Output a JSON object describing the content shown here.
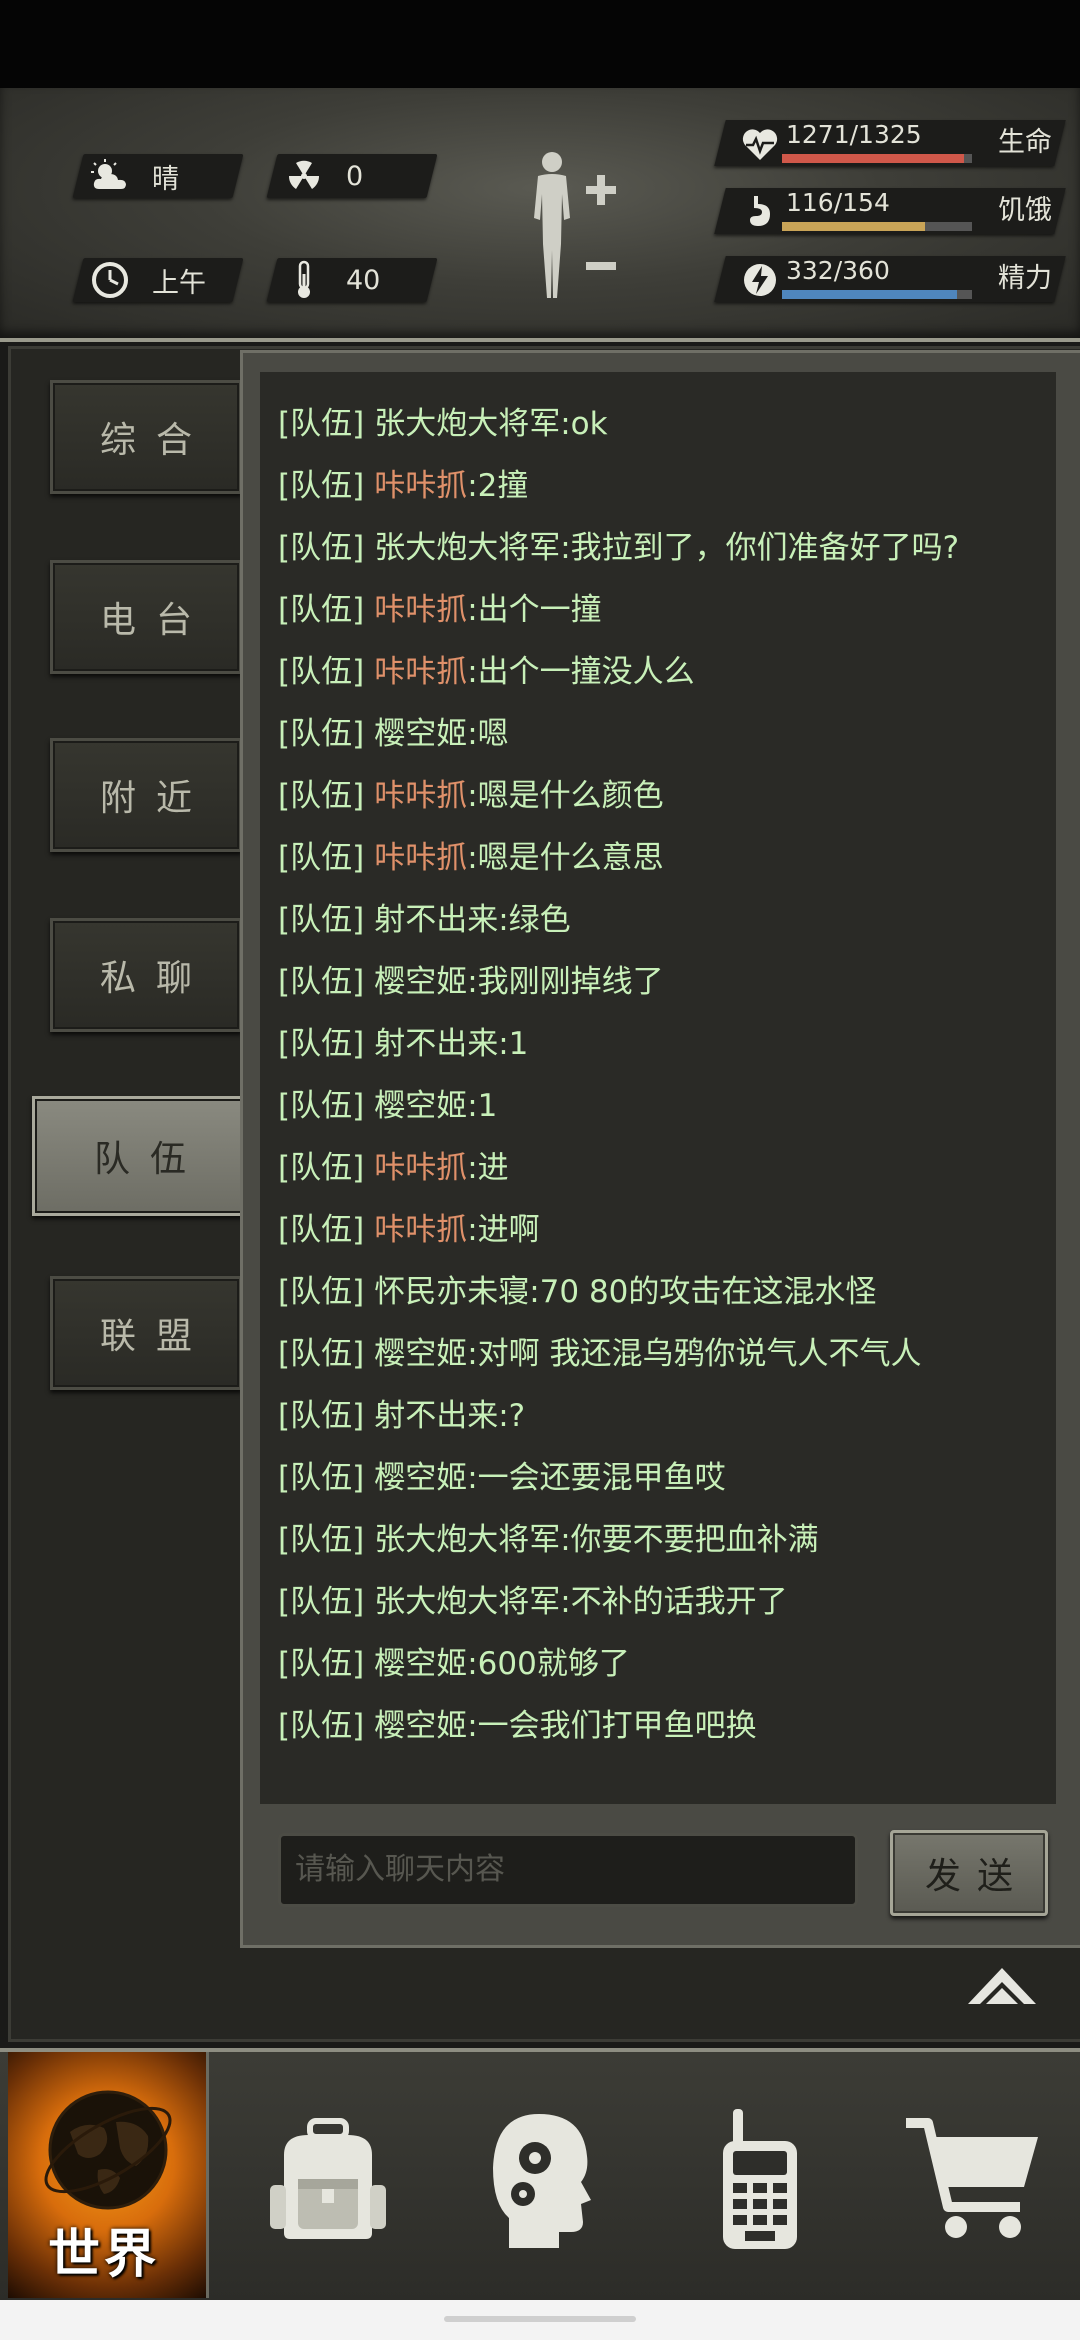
{
  "hud": {
    "weather_label": "晴",
    "radiation_value": "0",
    "time_label": "上午",
    "temperature_value": "40",
    "icons": [
      "partly-cloudy-icon",
      "radiation-icon",
      "clock-icon",
      "thermometer-icon",
      "body-figure-icon",
      "plus-icon",
      "minus-icon"
    ]
  },
  "stats": {
    "health": {
      "value": "1271/1325",
      "label": "生命",
      "fill": 0.959,
      "color": "#d0584a"
    },
    "hunger": {
      "value": "116/154",
      "label": "饥饿",
      "fill": 0.753,
      "color": "#c9a457"
    },
    "energy": {
      "value": "332/360",
      "label": "精力",
      "fill": 0.922,
      "color": "#4f86bd"
    }
  },
  "sidebar": {
    "items": [
      {
        "label": "综合"
      },
      {
        "label": "电台"
      },
      {
        "label": "附近"
      },
      {
        "label": "私聊"
      },
      {
        "label": "队伍",
        "active": true
      },
      {
        "label": "联盟"
      }
    ]
  },
  "chat": {
    "messages": [
      {
        "tag": "[队伍]",
        "speaker": "张大炮大将军",
        "text": ":ok",
        "highlight": false
      },
      {
        "tag": "[队伍]",
        "speaker": "咔咔抓",
        "text": ":2撞",
        "highlight": true
      },
      {
        "tag": "[队伍]",
        "speaker": "张大炮大将军",
        "text": ":我拉到了，你们准备好了吗?",
        "highlight": false
      },
      {
        "tag": "[队伍]",
        "speaker": "咔咔抓",
        "text": ":出个一撞",
        "highlight": true
      },
      {
        "tag": "[队伍]",
        "speaker": "咔咔抓",
        "text": ":出个一撞没人么",
        "highlight": true
      },
      {
        "tag": "[队伍]",
        "speaker": "樱空姬",
        "text": ":嗯",
        "highlight": false
      },
      {
        "tag": "[队伍]",
        "speaker": "咔咔抓",
        "text": ":嗯是什么颜色",
        "highlight": true
      },
      {
        "tag": "[队伍]",
        "speaker": "咔咔抓",
        "text": ":嗯是什么意思",
        "highlight": true
      },
      {
        "tag": "[队伍]",
        "speaker": "射不出来",
        "text": ":绿色",
        "highlight": false
      },
      {
        "tag": "[队伍]",
        "speaker": "樱空姬",
        "text": ":我刚刚掉线了",
        "highlight": false
      },
      {
        "tag": "[队伍]",
        "speaker": "射不出来",
        "text": ":1",
        "highlight": false
      },
      {
        "tag": "[队伍]",
        "speaker": "樱空姬",
        "text": ":1",
        "highlight": false
      },
      {
        "tag": "[队伍]",
        "speaker": "咔咔抓",
        "text": ":进",
        "highlight": true
      },
      {
        "tag": "[队伍]",
        "speaker": "咔咔抓",
        "text": ":进啊",
        "highlight": true
      },
      {
        "tag": "[队伍]",
        "speaker": "怀民亦未寝",
        "text": ":70 80的攻击在这混水怪",
        "highlight": false
      },
      {
        "tag": "[队伍]",
        "speaker": "樱空姬",
        "text": ":对啊 我还混乌鸦你说气人不气人",
        "highlight": false
      },
      {
        "tag": "[队伍]",
        "speaker": "射不出来",
        "text": ":?",
        "highlight": false
      },
      {
        "tag": "[队伍]",
        "speaker": "樱空姬",
        "text": ":一会还要混甲鱼哎",
        "highlight": false
      },
      {
        "tag": "[队伍]",
        "speaker": "张大炮大将军",
        "text": ":你要不要把血补满",
        "highlight": false
      },
      {
        "tag": "[队伍]",
        "speaker": "张大炮大将军",
        "text": ":不补的话我开了",
        "highlight": false
      },
      {
        "tag": "[队伍]",
        "speaker": "樱空姬",
        "text": ":600就够了",
        "highlight": false
      },
      {
        "tag": "[队伍]",
        "speaker": "樱空姬",
        "text": ":一会我们打甲鱼吧换",
        "highlight": false
      }
    ],
    "input_placeholder": "请输入聊天内容",
    "send_label": "发送"
  },
  "nav": {
    "world_label": "世界",
    "items": [
      "backpack-icon",
      "brain-skills-icon",
      "walkie-talkie-icon",
      "shopping-cart-icon"
    ]
  }
}
